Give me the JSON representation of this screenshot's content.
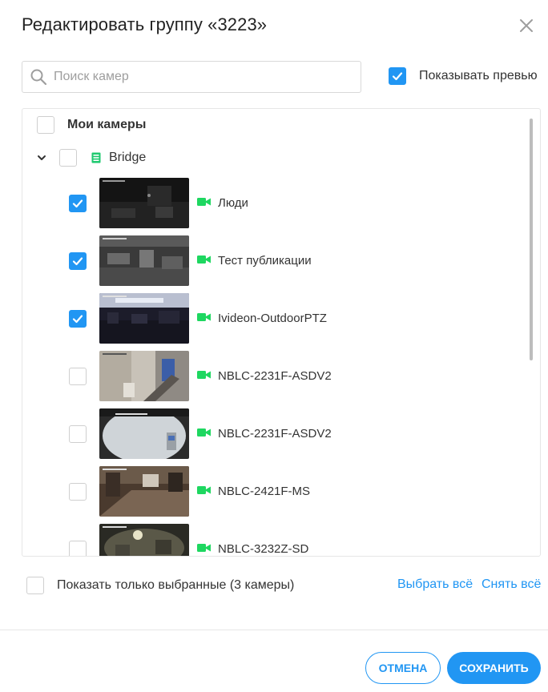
{
  "dialog": {
    "title": "Редактировать группу «3223»",
    "close_icon": "close-icon"
  },
  "search": {
    "placeholder": "Поиск камер",
    "value": "",
    "icon": "search-icon"
  },
  "preview": {
    "label": "Показывать превью",
    "checked": true
  },
  "tree": {
    "root": {
      "label": "Мои камеры",
      "checked": false
    },
    "group": {
      "label": "Bridge",
      "expanded": true,
      "checked": false,
      "icon": "server-icon"
    },
    "cameras": [
      {
        "label": "Люди",
        "checked": true
      },
      {
        "label": "Тест публикации",
        "checked": true
      },
      {
        "label": "Ivideon-OutdoorPTZ",
        "checked": true
      },
      {
        "label": "NBLC-2231F-ASDV2",
        "checked": false
      },
      {
        "label": "NBLC-2231F-ASDV2",
        "checked": false
      },
      {
        "label": "NBLC-2421F-MS",
        "checked": false
      },
      {
        "label": "NBLC-3232Z-SD",
        "checked": false
      }
    ]
  },
  "footer": {
    "only_selected_label": "Показать только выбранные (3 камеры)",
    "select_all": "Выбрать всё",
    "deselect_all": "Снять всё",
    "cancel": "Отмена",
    "save": "Сохранить"
  },
  "colors": {
    "accent": "#2196f3",
    "camera_icon": "#1ed760",
    "group_icon": "#1ec96f"
  }
}
